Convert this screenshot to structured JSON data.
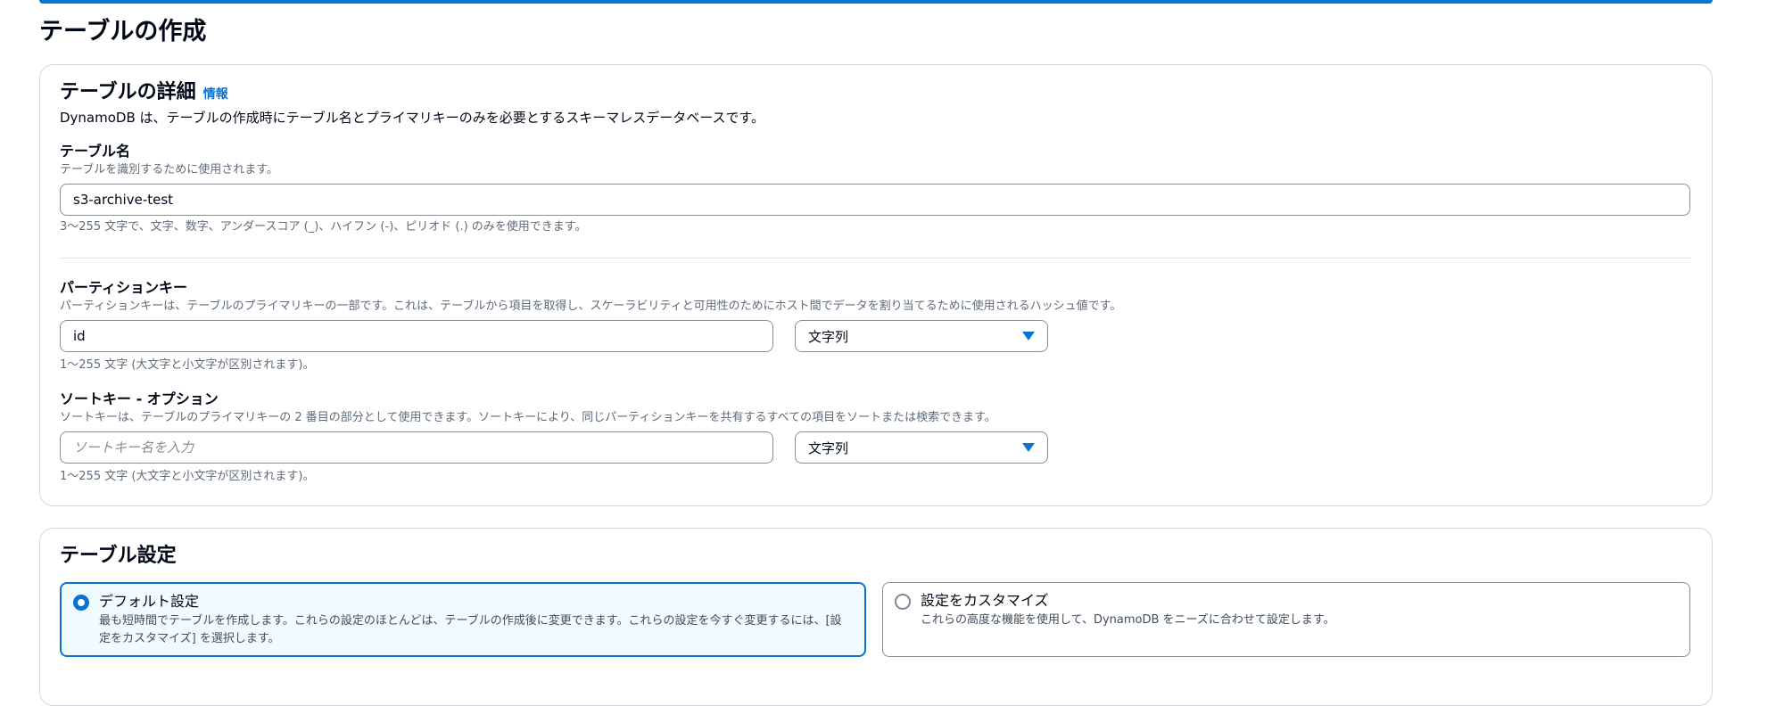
{
  "page": {
    "title": "テーブルの作成"
  },
  "table_details": {
    "heading": "テーブルの詳細",
    "info_link": "情報",
    "description": "DynamoDB は、テーブルの作成時にテーブル名とプライマリキーのみを必要とするスキーマレスデータベースです。",
    "table_name": {
      "label": "テーブル名",
      "hint": "テーブルを識別するために使用されます。",
      "value": "s3-archive-test",
      "constraint": "3〜255 文字で、文字、数字、アンダースコア (_)、ハイフン (-)、ピリオド (.) のみを使用できます。"
    },
    "partition_key": {
      "label": "パーティションキー",
      "hint": "パーティションキーは、テーブルのプライマリキーの一部です。これは、テーブルから項目を取得し、スケーラビリティと可用性のためにホスト間でデータを割り当てるために使用されるハッシュ値です。",
      "value": "id",
      "type_selected": "文字列",
      "constraint": "1〜255 文字 (大文字と小文字が区別されます)。"
    },
    "sort_key": {
      "label": "ソートキー - オプション",
      "hint": "ソートキーは、テーブルのプライマリキーの 2 番目の部分として使用できます。ソートキーにより、同じパーティションキーを共有するすべての項目をソートまたは検索できます。",
      "placeholder": "ソートキー名を入力",
      "type_selected": "文字列",
      "constraint": "1〜255 文字 (大文字と小文字が区別されます)。"
    }
  },
  "table_settings": {
    "heading": "テーブル設定",
    "options": [
      {
        "title": "デフォルト設定",
        "description": "最も短時間でテーブルを作成します。これらの設定のほとんどは、テーブルの作成後に変更できます。これらの設定を今すぐ変更するには、[設定をカスタマイズ] を選択します。",
        "selected": true
      },
      {
        "title": "設定をカスタマイズ",
        "description": "これらの高度な機能を使用して、DynamoDB をニーズに合わせて設定します。",
        "selected": false
      }
    ]
  },
  "colors": {
    "accent": "#0972d3",
    "selected_bg": "#f0fbff",
    "text": "#000716",
    "muted": "#5f6b7a"
  }
}
